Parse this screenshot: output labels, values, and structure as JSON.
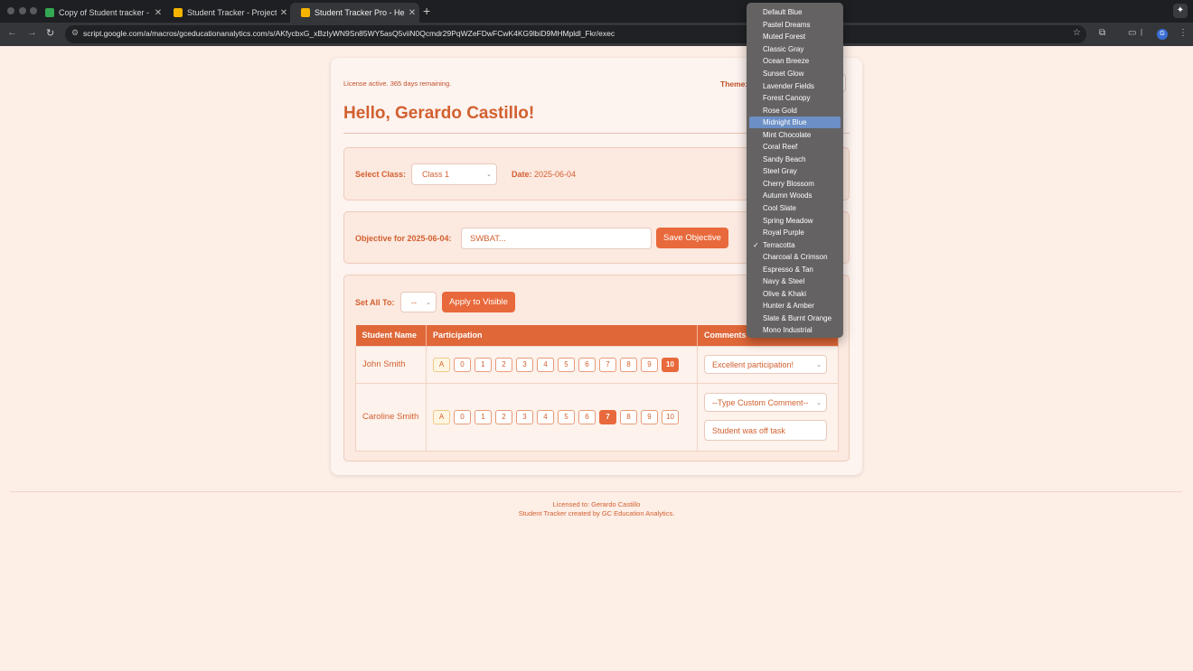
{
  "browser": {
    "tabs": [
      {
        "title": "Copy of Student tracker - Go",
        "favicon_color": "#34a853",
        "active": false
      },
      {
        "title": "Student Tracker - Project Edit",
        "favicon_color": "#f4b400",
        "active": false
      },
      {
        "title": "Student Tracker Pro - Hello, G",
        "favicon_color": "#f4b400",
        "active": true
      }
    ],
    "url": "script.google.com/a/macros/gceducationanalytics.com/s/AKfycbxG_xBzIyWN9Sn85WY5asQ5viiN0Qcmdr29PqWZeFDwFCwK4KG9lbiD9MHMpldl_Fkr/exec",
    "profile_initial": "G"
  },
  "page": {
    "license_status": "License active. 365 days remaining.",
    "theme_label": "Theme:",
    "greeting": "Hello, Gerardo Castillo!",
    "class_label": "Select Class:",
    "class_value": "Class 1",
    "date_label": "Date:",
    "date_value": "2025-06-04",
    "objective_label": "Objective for 2025-06-04:",
    "objective_placeholder": "SWBAT...",
    "save_objective": "Save Objective",
    "set_all_label": "Set All To:",
    "set_all_value": "--",
    "apply_visible": "Apply to Visible",
    "table": {
      "headers": [
        "Student Name",
        "Participation",
        "Comments"
      ],
      "absent_label": "A",
      "scores": [
        "0",
        "1",
        "2",
        "3",
        "4",
        "5",
        "6",
        "7",
        "8",
        "9",
        "10"
      ],
      "rows": [
        {
          "name": "John Smith",
          "selected": "10",
          "comment_select": "Excellent participation!",
          "comment_text": ""
        },
        {
          "name": "Caroline Smith",
          "selected": "7",
          "comment_select": "--Type Custom Comment--",
          "comment_text": "Student was off task"
        }
      ]
    }
  },
  "footer": {
    "licensed_to": "Licensed to: Gerardo Castillo",
    "credit": "Student Tracker created by GC Education Analytics."
  },
  "theme_dropdown": {
    "highlighted": "Midnight Blue",
    "checked": "Terracotta",
    "options": [
      "Default Blue",
      "Pastel Dreams",
      "Muted Forest",
      "Classic Gray",
      "Ocean Breeze",
      "Sunset Glow",
      "Lavender Fields",
      "Forest Canopy",
      "Rose Gold",
      "Midnight Blue",
      "Mint Chocolate",
      "Coral Reef",
      "Sandy Beach",
      "Steel Gray",
      "Cherry Blossom",
      "Autumn Woods",
      "Cool Slate",
      "Spring Meadow",
      "Royal Purple",
      "Terracotta",
      "Charcoal & Crimson",
      "Espresso & Tan",
      "Navy & Steel",
      "Olive & Khaki",
      "Hunter & Amber",
      "Slate & Burnt Orange",
      "Mono Industrial"
    ]
  },
  "colors": {
    "accent": "#e8693b",
    "text": "#d2602f",
    "page_bg": "#fdeee6",
    "header_bg": "#df6738",
    "dropdown_highlight": "#6b8fc6"
  }
}
